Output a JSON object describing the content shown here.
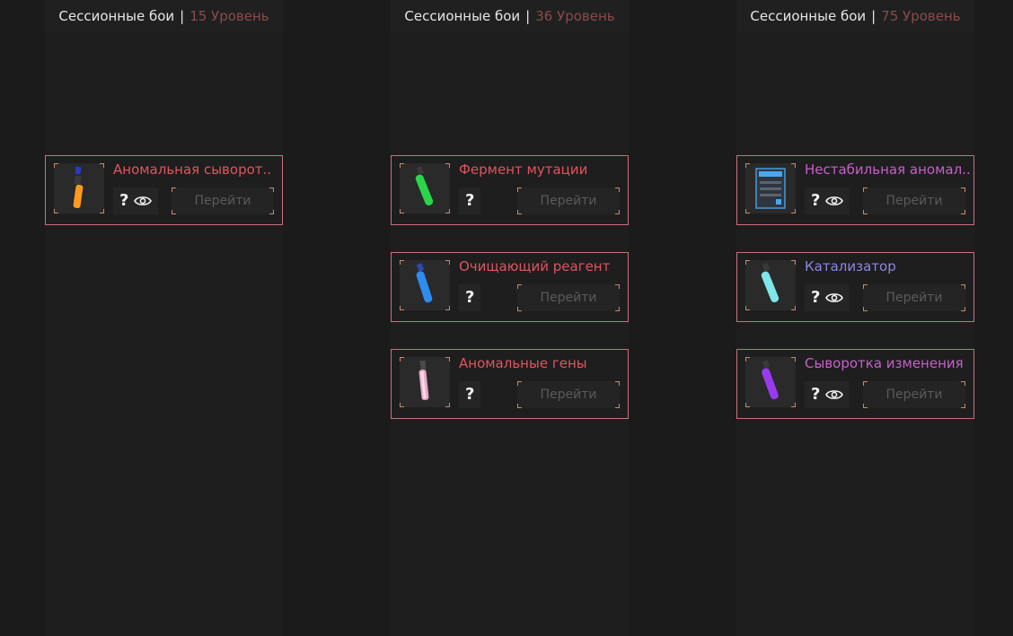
{
  "columns": [
    {
      "header": {
        "title": "Сессионные бои",
        "separator": "|",
        "level": "15 Уровень"
      },
      "items": [
        {
          "name": "Аномальная сыворот..",
          "name_color": "#e0545f",
          "has_eye": true,
          "go_label": "Перейти",
          "icon": "orange-vial-icon"
        }
      ]
    },
    {
      "header": {
        "title": "Сессионные бои",
        "separator": "|",
        "level": "36 Уровень"
      },
      "items": [
        {
          "name": "Фермент мутации",
          "name_color": "#e0545f",
          "has_eye": false,
          "go_label": "Перейти",
          "icon": "green-vial-icon"
        },
        {
          "name": "Очищающий реагент",
          "name_color": "#e0545f",
          "has_eye": false,
          "go_label": "Перейти",
          "icon": "blue-vial-icon"
        },
        {
          "name": "Аномальные гены",
          "name_color": "#e0545f",
          "has_eye": false,
          "go_label": "Перейти",
          "icon": "pink-vial-icon"
        }
      ]
    },
    {
      "header": {
        "title": "Сессионные бои",
        "separator": "|",
        "level": "75 Уровень"
      },
      "items": [
        {
          "name": "Нестабильная аномал..",
          "name_color": "#c660c9",
          "has_eye": true,
          "go_label": "Перейти",
          "icon": "blue-container-icon"
        },
        {
          "name": "Катализатор",
          "name_color": "#8c87e6",
          "has_eye": true,
          "go_label": "Перейти",
          "icon": "cyan-vial-icon"
        },
        {
          "name": "Сыворотка изменения",
          "name_color": "#c660c9",
          "has_eye": true,
          "go_label": "Перейти",
          "icon": "purple-vial-icon"
        }
      ]
    }
  ]
}
